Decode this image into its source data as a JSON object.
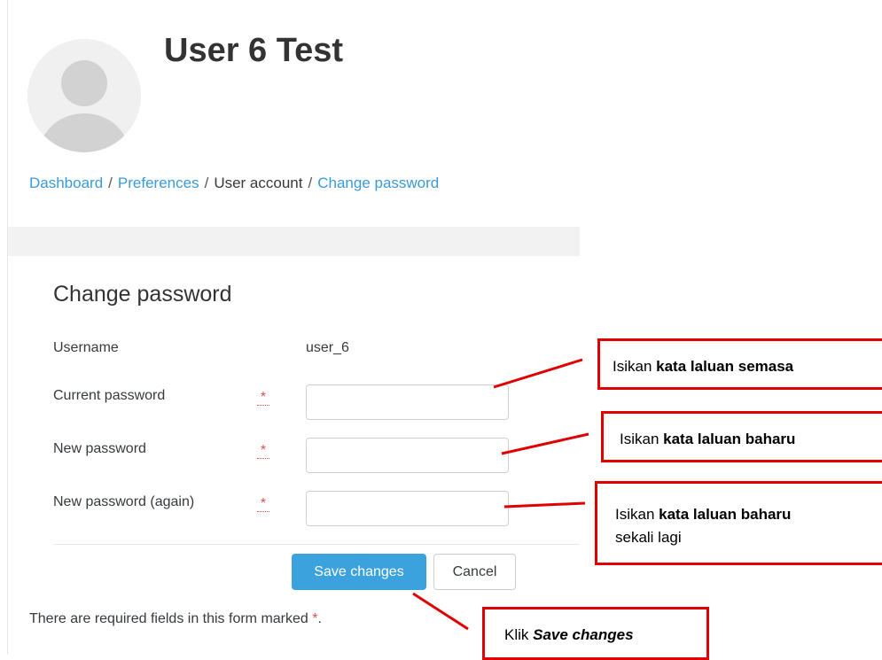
{
  "profile": {
    "name": "User 6 Test"
  },
  "breadcrumb": {
    "items": [
      "Dashboard",
      "Preferences",
      "User account",
      "Change password"
    ],
    "separator": "/"
  },
  "form": {
    "title": "Change password",
    "username_label": "Username",
    "username_value": "user_6",
    "current_password_label": "Current password",
    "new_password_label": "New password",
    "new_password_again_label": "New password (again)",
    "required_marker": "*",
    "current_password_value": "",
    "new_password_value": "",
    "new_password_again_value": "",
    "save_label": "Save changes",
    "cancel_label": "Cancel",
    "required_note": "There are required fields in this form marked",
    "required_note_end": "."
  },
  "annotations": {
    "current": {
      "prefix": "Isikan ",
      "bold": "kata laluan semasa"
    },
    "new": {
      "prefix": "Isikan ",
      "bold": "kata laluan baharu"
    },
    "again": {
      "prefix": "Isikan ",
      "bold": "kata laluan baharu",
      "suffix": "sekali lagi"
    },
    "save": {
      "prefix": "Klik ",
      "bold_italic": "Save changes"
    }
  },
  "colors": {
    "accent": "#3ba2dd",
    "link": "#3a9ad9",
    "required": "#d9534f",
    "annotation": "#e00000"
  }
}
